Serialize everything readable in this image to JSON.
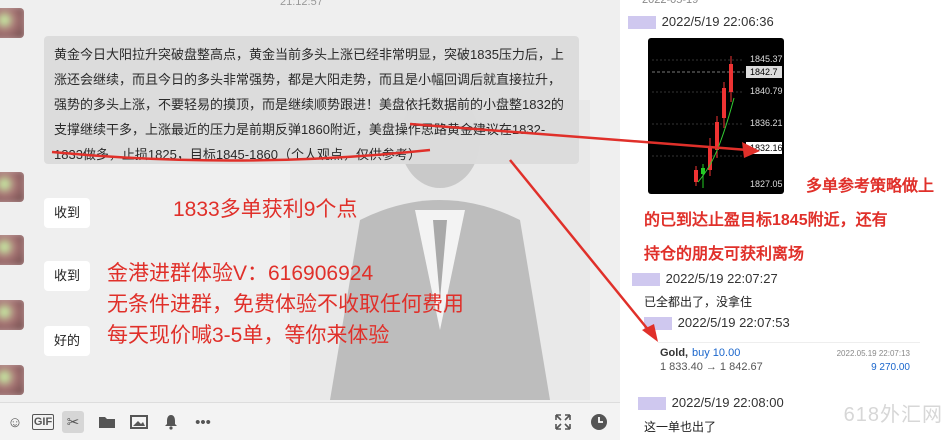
{
  "chat": {
    "timestamp_top": "21:12:57",
    "main_message": "黄金今日大阳拉升突破盘整高点，黄金当前多头上涨已经非常明显，突破1835压力后，上涨还会继续，而且今日的多头非常强势，都是大阳走势，而且是小幅回调后就直接拉升，强势的多头上涨，不要轻易的摸顶，而是继续顺势跟进！美盘依托数据前的小盘整1832的支撑继续干多，上涨最近的压力是前期反弹1860附近，美盘操作思路黄金建议在1832-1833做多，止损1825，目标1845-1860（个人观点，仅供参考）",
    "reply_1": "收到",
    "reply_2": "收到",
    "reply_3": "好的",
    "profit_note": "1833多单获利9个点",
    "group_line_1": "金港进群体验V：616906924",
    "group_line_2": "无条件进群，免费体验不收取任何费用",
    "group_line_3": "每天现价喊3-5单，等你来体验"
  },
  "toolbar": {
    "emoji_icon": "emoji-icon",
    "gif_label": "GIF",
    "scissors_icon": "scissors-icon",
    "folder_icon": "folder-icon",
    "image_icon": "image-icon",
    "bell_icon": "bell-icon",
    "more_icon": "more-icon",
    "expand_icon": "expand-icon",
    "history_icon": "history-icon"
  },
  "right": {
    "date_top": "2022-05-19",
    "ts1": "2022/5/19 22:06:36",
    "chart_prices": [
      "1845.37",
      "1842.7",
      "1840.79",
      "1836.21",
      "1832.16",
      "1827.05"
    ],
    "red_note_1": "多单参考策略做上",
    "red_note_2": "的已到达止盈目标1845附近，还有",
    "red_note_3": "持仓的朋友可获利离场",
    "ts2": "2022/5/19 22:07:27",
    "msg2": "已全都出了，没拿住",
    "ts3": "2022/5/19 22:07:53",
    "trade": {
      "symbol": "Gold,",
      "side": "buy 10.00",
      "datetime": "2022.05.19 22:07:13",
      "prices": "1 833.40 → 1 842.67",
      "profit": "9 270.00"
    },
    "ts4": "2022/5/19 22:08:00",
    "msg4": "这一单也出了",
    "watermark": "618外汇网"
  },
  "colors": {
    "accent_red": "#e0302a",
    "buy_blue": "#1a66cc"
  }
}
